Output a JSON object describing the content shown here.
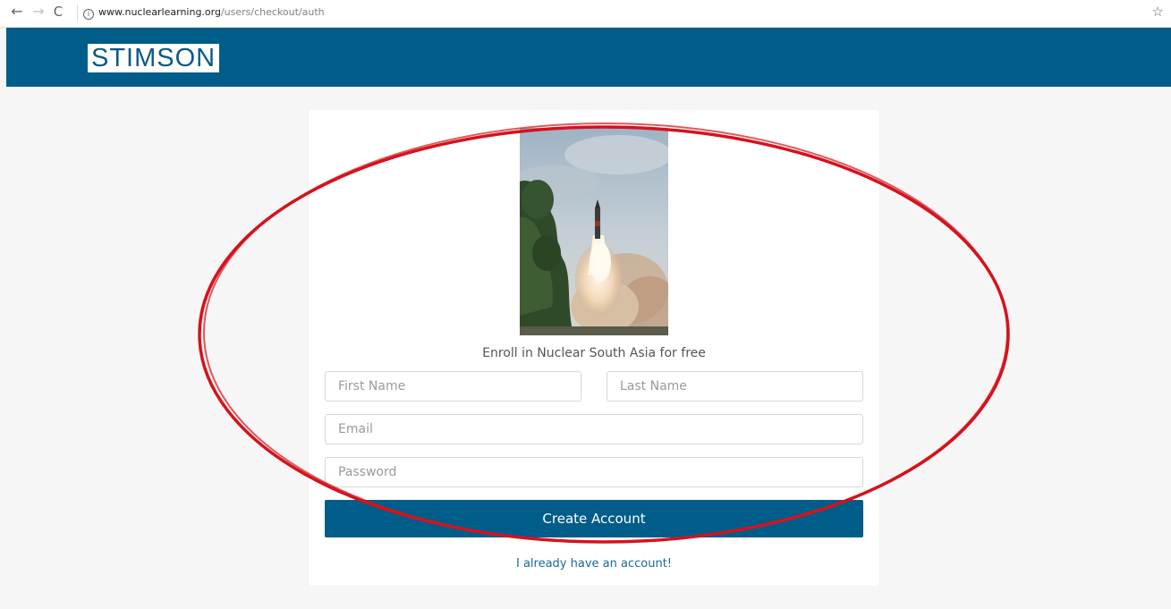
{
  "browser": {
    "url_host": "www.nuclearlearning.org",
    "url_path": "/users/checkout/auth",
    "back_glyph": "←",
    "forward_glyph": "→",
    "reload_glyph": "C",
    "info_glyph": "i",
    "star_glyph": "☆"
  },
  "header": {
    "logo_text": "STIMSON",
    "background_color": "#005d8a"
  },
  "card": {
    "enroll_text": "Enroll in Nuclear South Asia for free",
    "first_name_placeholder": "First Name",
    "last_name_placeholder": "Last Name",
    "email_placeholder": "Email",
    "password_placeholder": "Password",
    "create_button_label": "Create Account",
    "login_link_text": "I already have an account!"
  },
  "colors": {
    "accent": "#005d8a",
    "annotation": "#d6121c"
  }
}
